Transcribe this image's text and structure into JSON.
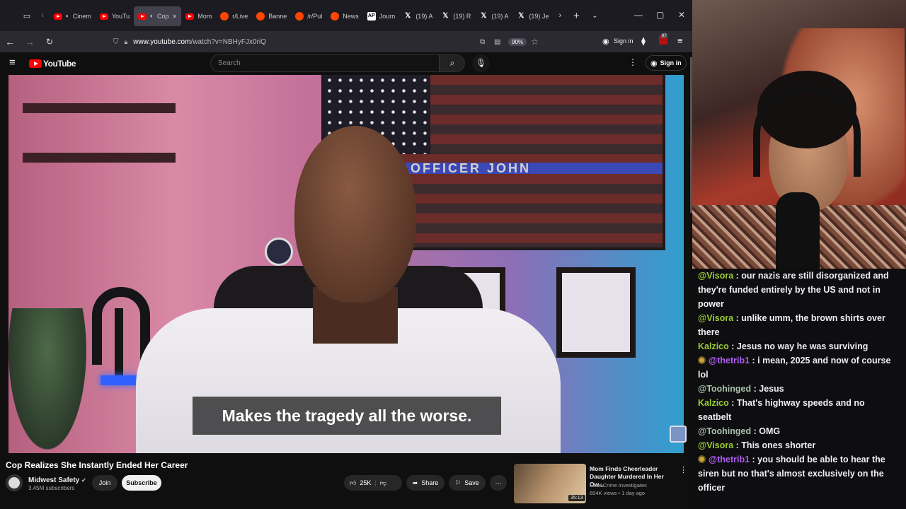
{
  "browser": {
    "tabs": [
      {
        "label": "Cinem",
        "icon": "youtube-icon",
        "audio": true
      },
      {
        "label": "YouTu",
        "icon": "youtube-icon",
        "audio": false
      },
      {
        "label": "Cop",
        "icon": "youtube-icon",
        "audio": true,
        "active": true
      },
      {
        "label": "Mom",
        "icon": "youtube-icon",
        "audio": false
      },
      {
        "label": "r/Live",
        "icon": "reddit-icon",
        "audio": false
      },
      {
        "label": "Banne",
        "icon": "reddit-icon",
        "audio": false
      },
      {
        "label": "/r/Pul",
        "icon": "reddit-icon",
        "audio": false
      },
      {
        "label": "News",
        "icon": "reddit-icon",
        "audio": false
      },
      {
        "label": "Journ",
        "icon": "ap-icon",
        "audio": false
      },
      {
        "label": "(19) A",
        "icon": "x-icon",
        "audio": false
      },
      {
        "label": "(19) R",
        "icon": "x-icon",
        "audio": false
      },
      {
        "label": "(19) A",
        "icon": "x-icon",
        "audio": false
      },
      {
        "label": "(19) Je",
        "icon": "x-icon",
        "audio": false
      }
    ],
    "url_host": "www.youtube.com",
    "url_path": "/watch?v=NBHyFJx0riQ",
    "zoom": "90%",
    "signin": "Sign in",
    "ext_badge": "97"
  },
  "youtube": {
    "logo": "YouTube",
    "search_placeholder": "Search",
    "signin": "Sign in",
    "caption": "Makes the tragedy all the worse.",
    "video_overlay_text": "OFFICER JOHN",
    "video_title": "Cop Realizes She Instantly Ended Her Career",
    "channel": "Midwest Safety",
    "subscribers": "3.45M subscribers",
    "join": "Join",
    "subscribe": "Subscribe",
    "likes": "25K",
    "share": "Share",
    "save": "Save",
    "recommended": {
      "title": "Mom Finds Cheerleader Daughter Murdered In Her Ow...",
      "channel": "Law&Crime Investigates",
      "meta": "654K views • 1 day ago",
      "duration": "35:13"
    }
  },
  "chat": [
    {
      "user": "@Visora",
      "color": "#9acd32",
      "badge": false,
      "text": "our nazis are still disorganized and they're funded entirely by the US and not in power"
    },
    {
      "user": "@Visora",
      "color": "#9acd32",
      "badge": false,
      "text": "unlike umm, the brown shirts over there"
    },
    {
      "user": "Kalzico",
      "color": "#9acd32",
      "badge": false,
      "text": "Jesus no way he was surviving"
    },
    {
      "user": "@thetrib1",
      "color": "#b05cf2",
      "badge": true,
      "text": "i mean, 2025 and now of course lol"
    },
    {
      "user": "@Toohinged",
      "color": "#a9c3ae",
      "badge": false,
      "text": "Jesus"
    },
    {
      "user": "Kalzico",
      "color": "#9acd32",
      "badge": false,
      "text": "That's highway speeds and no seatbelt"
    },
    {
      "user": "@Toohinged",
      "color": "#a9c3ae",
      "badge": false,
      "text": "OMG"
    },
    {
      "user": "@Visora",
      "color": "#9acd32",
      "badge": false,
      "text": "This ones shorter"
    },
    {
      "user": "@thetrib1",
      "color": "#b05cf2",
      "badge": true,
      "text": "you should be able to hear the siren but no that's almost exclusively on the officer"
    }
  ]
}
